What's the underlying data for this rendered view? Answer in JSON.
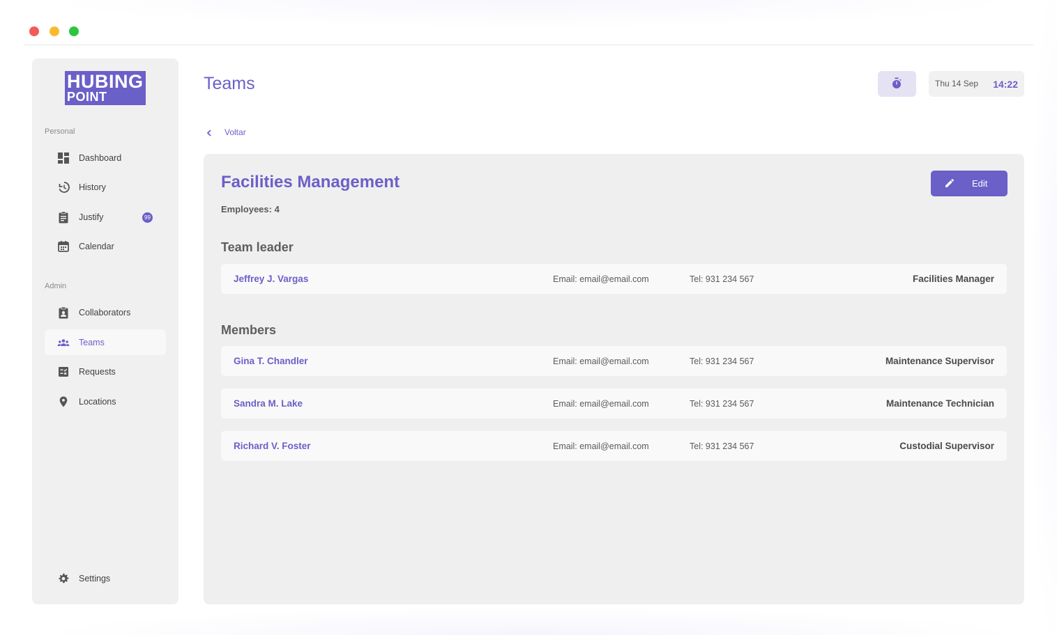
{
  "logo": {
    "line1": "HUBING",
    "line2": "POINT"
  },
  "sidebar": {
    "personal_label": "Personal",
    "personal_items": [
      {
        "label": "Dashboard",
        "icon": "dashboard-icon"
      },
      {
        "label": "History",
        "icon": "history-icon"
      },
      {
        "label": "Justify",
        "icon": "clipboard-icon",
        "badge": "99"
      },
      {
        "label": "Calendar",
        "icon": "calendar-icon"
      }
    ],
    "admin_label": "Admin",
    "admin_items": [
      {
        "label": "Collaborators",
        "icon": "collaborators-icon"
      },
      {
        "label": "Teams",
        "icon": "teams-icon",
        "active": true
      },
      {
        "label": "Requests",
        "icon": "requests-icon"
      },
      {
        "label": "Locations",
        "icon": "location-pin-icon"
      }
    ],
    "settings_label": "Settings"
  },
  "header": {
    "title": "Teams",
    "date": "Thu 14 Sep",
    "time": "14:22",
    "back_label": "Voltar"
  },
  "team": {
    "name": "Facilities Management",
    "employees": "Employees: 4",
    "edit_label": "Edit",
    "leader_title": "Team leader",
    "members_title": "Members",
    "leader": {
      "name": "Jeffrey J. Vargas",
      "email": "Email: email@email.com",
      "tel": "Tel: 931 234 567",
      "role": "Facilities Manager"
    },
    "members": [
      {
        "name": "Gina T. Chandler",
        "email": "Email: email@email.com",
        "tel": "Tel: 931 234 567",
        "role": "Maintenance Supervisor"
      },
      {
        "name": "Sandra M. Lake",
        "email": "Email: email@email.com",
        "tel": "Tel: 931 234 567",
        "role": "Maintenance Technician"
      },
      {
        "name": "Richard V. Foster",
        "email": "Email: email@email.com",
        "tel": "Tel: 931 234 567",
        "role": "Custodial Supervisor"
      }
    ]
  },
  "colors": {
    "accent": "#6b5fc8",
    "sidebar_bg": "#f0f0f0",
    "card_bg": "#efefef"
  }
}
